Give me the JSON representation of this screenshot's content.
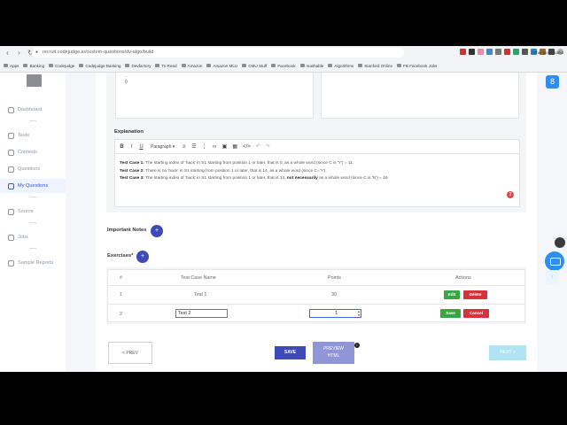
{
  "browser": {
    "url": "recruit.codejudge.io/custom-questions/dv-algo/build",
    "bookmarks": [
      "Apps",
      "Banking",
      "Codejudge",
      "Codejudge Banking",
      "Devfactory",
      "To Read",
      "Amazon",
      "Amazon MLU",
      "CMU Stuff",
      "Facebook",
      "mashable",
      "Algorithms",
      "Stanford Online",
      "FB Facebook Jobs"
    ],
    "other_bookmarks": "Other Bookmarks"
  },
  "sidebar": {
    "items": [
      {
        "label": "Dashboard",
        "icon": "home-icon"
      },
      {
        "label": "Tests",
        "icon": "file-icon"
      },
      {
        "label": "Contests",
        "icon": "trophy-icon"
      },
      {
        "label": "Questions",
        "icon": "question-icon"
      },
      {
        "label": "My Questions",
        "icon": "folder-icon"
      },
      {
        "label": "Source",
        "icon": "search-icon"
      },
      {
        "label": "Jobs",
        "icon": "briefcase-icon"
      },
      {
        "label": "Sample Reports",
        "icon": "report-icon"
      }
    ],
    "active": "My Questions"
  },
  "help_badge": "8",
  "top_box": {
    "line1": "-",
    "line2": "0"
  },
  "explanation": {
    "label": "Explanation",
    "toolbar": {
      "bold": "B",
      "italic": "I",
      "underline": "U",
      "paragraph": "Paragraph ▾"
    },
    "lines": [
      {
        "head": "Test Case 1:",
        "text": " The starting index of 'hack' in S1 starting from position 1 or later, that is 0, as a whole word (since C is 'Y') = 11."
      },
      {
        "head": "Test Case 2:",
        "text": " There is no 'hack' in S1 starting from position 1 or later, that is 14, as a whole word (since C='Y')."
      },
      {
        "head": "Test Case 3:",
        "text": " The starting index of 'hack' in S1 starting from position 1 or later, that is 14, ",
        "bold_tail": "not necessarily",
        "tail": " as a whole word (since C is 'N') = 19."
      }
    ],
    "error_count": "2"
  },
  "important_notes": {
    "label": "Important Notes",
    "plus": "+"
  },
  "exercises": {
    "label": "Exercises*",
    "plus": "+",
    "headers": [
      "#",
      "Test Case Name",
      "Points",
      "Actions"
    ],
    "rows": [
      {
        "num": "1",
        "name": "Test 1",
        "points": "30",
        "action1": "Edit",
        "action2": "Delete"
      },
      {
        "num": "2",
        "name": "Test 2",
        "points": "1",
        "action1": "Save",
        "action2": "Cancel"
      }
    ]
  },
  "footer": {
    "prev": "< PREV",
    "save": "SAVE",
    "preview_line1": "PREVIEW",
    "preview_line2": "HTML",
    "info": "i",
    "next": "NEXT >"
  },
  "colors": {
    "accent": "#3e4bb7",
    "green": "#38a643",
    "red": "#d9303b",
    "next": "#aee4f4"
  }
}
